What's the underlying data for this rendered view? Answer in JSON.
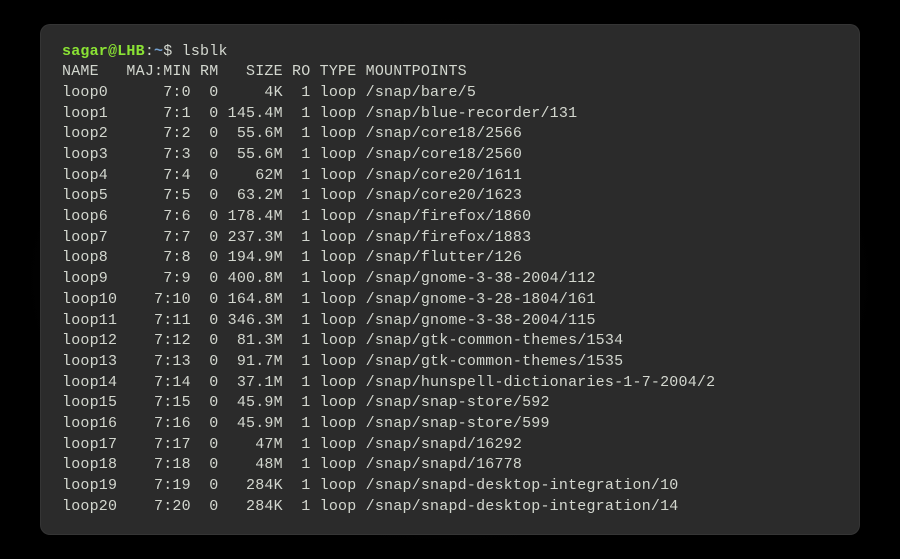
{
  "prompt": {
    "user": "sagar",
    "at": "@",
    "host": "LHB",
    "colon": ":",
    "path": "~",
    "dollar": "$ ",
    "command": "lsblk"
  },
  "header": {
    "name": "NAME",
    "majmin": "MAJ:MIN",
    "rm": "RM",
    "size": "SIZE",
    "ro": "RO",
    "type": "TYPE",
    "mount": "MOUNTPOINTS"
  },
  "rows": [
    {
      "name": "loop0",
      "majmin": "7:0",
      "rm": "0",
      "size": "4K",
      "ro": "1",
      "type": "loop",
      "mount": "/snap/bare/5"
    },
    {
      "name": "loop1",
      "majmin": "7:1",
      "rm": "0",
      "size": "145.4M",
      "ro": "1",
      "type": "loop",
      "mount": "/snap/blue-recorder/131"
    },
    {
      "name": "loop2",
      "majmin": "7:2",
      "rm": "0",
      "size": "55.6M",
      "ro": "1",
      "type": "loop",
      "mount": "/snap/core18/2566"
    },
    {
      "name": "loop3",
      "majmin": "7:3",
      "rm": "0",
      "size": "55.6M",
      "ro": "1",
      "type": "loop",
      "mount": "/snap/core18/2560"
    },
    {
      "name": "loop4",
      "majmin": "7:4",
      "rm": "0",
      "size": "62M",
      "ro": "1",
      "type": "loop",
      "mount": "/snap/core20/1611"
    },
    {
      "name": "loop5",
      "majmin": "7:5",
      "rm": "0",
      "size": "63.2M",
      "ro": "1",
      "type": "loop",
      "mount": "/snap/core20/1623"
    },
    {
      "name": "loop6",
      "majmin": "7:6",
      "rm": "0",
      "size": "178.4M",
      "ro": "1",
      "type": "loop",
      "mount": "/snap/firefox/1860"
    },
    {
      "name": "loop7",
      "majmin": "7:7",
      "rm": "0",
      "size": "237.3M",
      "ro": "1",
      "type": "loop",
      "mount": "/snap/firefox/1883"
    },
    {
      "name": "loop8",
      "majmin": "7:8",
      "rm": "0",
      "size": "194.9M",
      "ro": "1",
      "type": "loop",
      "mount": "/snap/flutter/126"
    },
    {
      "name": "loop9",
      "majmin": "7:9",
      "rm": "0",
      "size": "400.8M",
      "ro": "1",
      "type": "loop",
      "mount": "/snap/gnome-3-38-2004/112"
    },
    {
      "name": "loop10",
      "majmin": "7:10",
      "rm": "0",
      "size": "164.8M",
      "ro": "1",
      "type": "loop",
      "mount": "/snap/gnome-3-28-1804/161"
    },
    {
      "name": "loop11",
      "majmin": "7:11",
      "rm": "0",
      "size": "346.3M",
      "ro": "1",
      "type": "loop",
      "mount": "/snap/gnome-3-38-2004/115"
    },
    {
      "name": "loop12",
      "majmin": "7:12",
      "rm": "0",
      "size": "81.3M",
      "ro": "1",
      "type": "loop",
      "mount": "/snap/gtk-common-themes/1534"
    },
    {
      "name": "loop13",
      "majmin": "7:13",
      "rm": "0",
      "size": "91.7M",
      "ro": "1",
      "type": "loop",
      "mount": "/snap/gtk-common-themes/1535"
    },
    {
      "name": "loop14",
      "majmin": "7:14",
      "rm": "0",
      "size": "37.1M",
      "ro": "1",
      "type": "loop",
      "mount": "/snap/hunspell-dictionaries-1-7-2004/2"
    },
    {
      "name": "loop15",
      "majmin": "7:15",
      "rm": "0",
      "size": "45.9M",
      "ro": "1",
      "type": "loop",
      "mount": "/snap/snap-store/592"
    },
    {
      "name": "loop16",
      "majmin": "7:16",
      "rm": "0",
      "size": "45.9M",
      "ro": "1",
      "type": "loop",
      "mount": "/snap/snap-store/599"
    },
    {
      "name": "loop17",
      "majmin": "7:17",
      "rm": "0",
      "size": "47M",
      "ro": "1",
      "type": "loop",
      "mount": "/snap/snapd/16292"
    },
    {
      "name": "loop18",
      "majmin": "7:18",
      "rm": "0",
      "size": "48M",
      "ro": "1",
      "type": "loop",
      "mount": "/snap/snapd/16778"
    },
    {
      "name": "loop19",
      "majmin": "7:19",
      "rm": "0",
      "size": "284K",
      "ro": "1",
      "type": "loop",
      "mount": "/snap/snapd-desktop-integration/10"
    },
    {
      "name": "loop20",
      "majmin": "7:20",
      "rm": "0",
      "size": "284K",
      "ro": "1",
      "type": "loop",
      "mount": "/snap/snapd-desktop-integration/14"
    }
  ]
}
